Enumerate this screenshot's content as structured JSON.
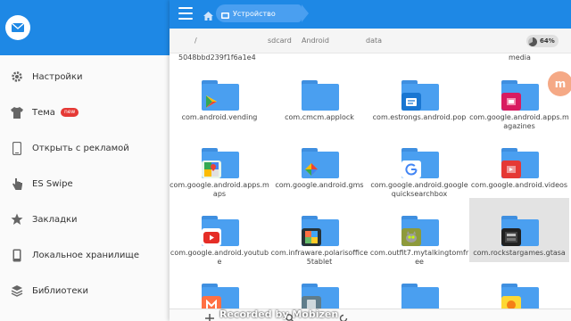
{
  "drawer": {
    "items": [
      {
        "label": "Настройки",
        "icon": "gear-icon"
      },
      {
        "label": "Тема",
        "icon": "shirt-icon",
        "badge": "new"
      },
      {
        "label": "Открыть с рекламой",
        "icon": "phone-icon"
      },
      {
        "label": "ES Swipe",
        "icon": "swipe-hand-icon"
      },
      {
        "label": "Закладки",
        "icon": "star-icon"
      },
      {
        "label": "Локальное хранилище",
        "icon": "phone-storage-icon"
      },
      {
        "label": "Библиотеки",
        "icon": "library-icon"
      }
    ]
  },
  "topbar": {
    "path_chip": "Устройство"
  },
  "breadcrumbs": {
    "items": [
      "/",
      "sdcard",
      "Android",
      "data"
    ],
    "storage_percent": "64%"
  },
  "files": {
    "partial_left": "5048bbd239f1f6a1e4",
    "partial_right": "media",
    "items": [
      {
        "name": "com.android.vending",
        "app_icon": "play-store-icon",
        "selected": false
      },
      {
        "name": "com.cmcm.applock",
        "app_icon": "",
        "selected": false
      },
      {
        "name": "com.estrongs.android.pop",
        "app_icon": "es-explorer-icon",
        "selected": false
      },
      {
        "name": "com.google.android.apps.magazines",
        "app_icon": "google-magazines-icon",
        "selected": false
      },
      {
        "name": "com.google.android.apps.maps",
        "app_icon": "google-maps-icon",
        "selected": false
      },
      {
        "name": "com.google.android.gms",
        "app_icon": "google-play-services-icon",
        "selected": false
      },
      {
        "name": "com.google.android.googlequicksearchbox",
        "app_icon": "google-g-icon",
        "selected": false
      },
      {
        "name": "com.google.android.videos",
        "app_icon": "google-play-movies-icon",
        "selected": false
      },
      {
        "name": "com.google.android.youtube",
        "app_icon": "youtube-icon",
        "selected": false
      },
      {
        "name": "com.infraware.polarisoffice5tablet",
        "app_icon": "polaris-office-icon",
        "selected": false
      },
      {
        "name": "com.outfit7.mytalkingtomfree",
        "app_icon": "talking-tom-icon",
        "selected": false
      },
      {
        "name": "com.rockstargames.gtasa",
        "app_icon": "gta-sa-icon",
        "selected": true
      }
    ]
  },
  "watermark": "Recorded by Mobizen",
  "colors": {
    "accent": "#1e88e5",
    "folder": "#4a9ff0",
    "selected_bg": "#e3e3e3"
  }
}
